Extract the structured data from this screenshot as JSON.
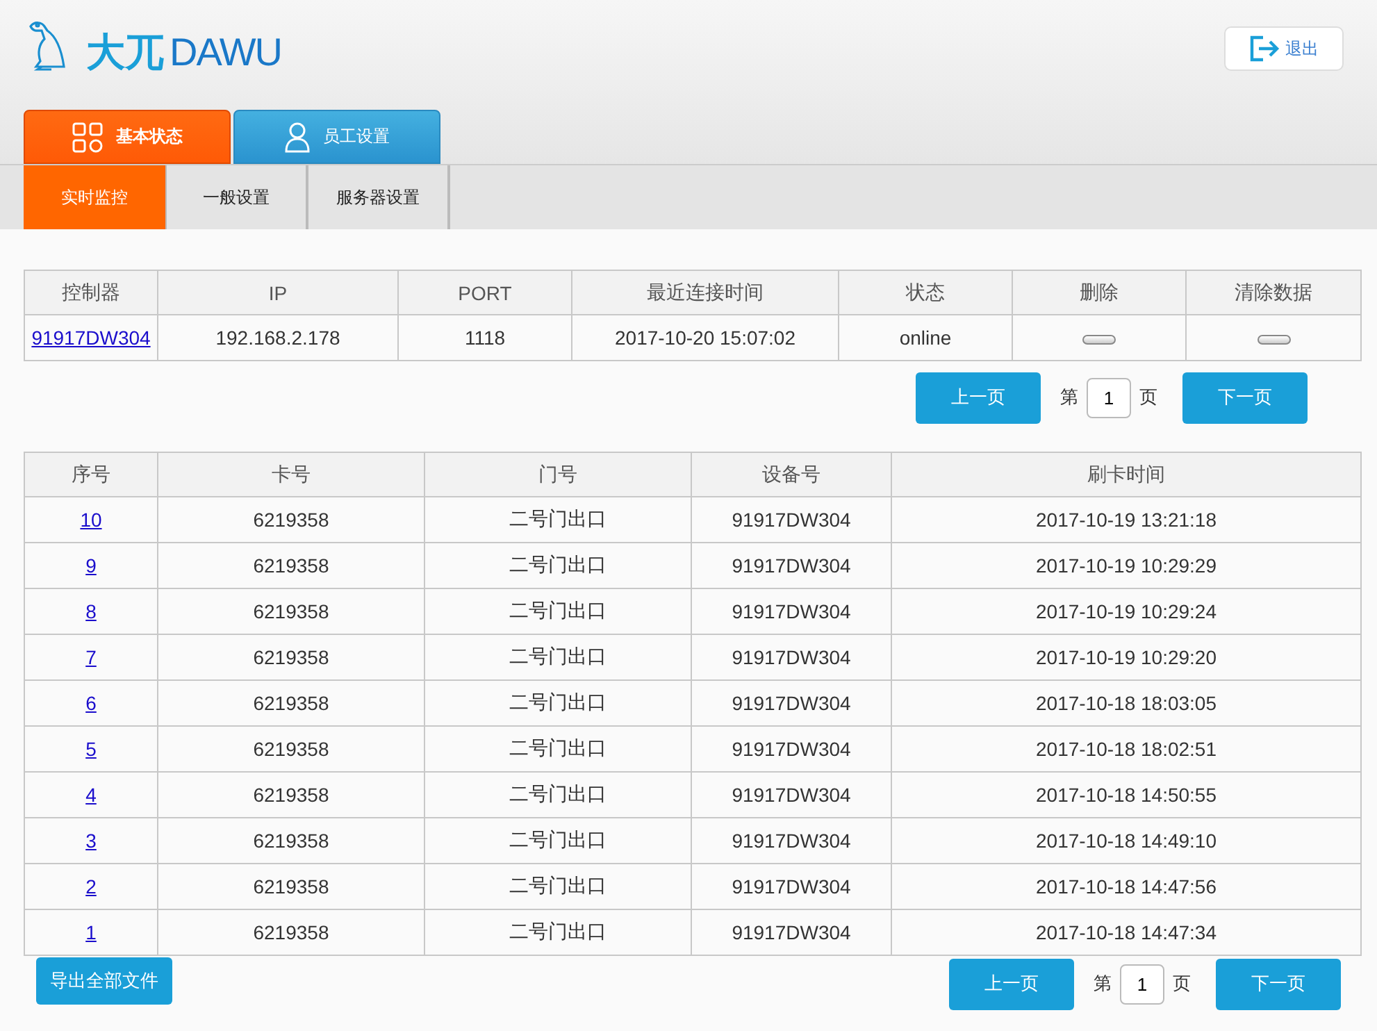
{
  "logo": {
    "mark": "大兀",
    "word": "DAWU"
  },
  "logout": {
    "label": "退出"
  },
  "tabs": [
    {
      "label": "基本状态",
      "kind": "grid",
      "selected": true
    },
    {
      "label": "员工设置",
      "kind": "user",
      "selected": false
    }
  ],
  "subtabs": [
    {
      "label": "实时监控",
      "selected": true
    },
    {
      "label": "一般设置",
      "selected": false
    },
    {
      "label": "服务器设置",
      "selected": false
    }
  ],
  "controllers": {
    "columns": [
      "控制器",
      "IP",
      "PORT",
      "最近连接时间",
      "状态",
      "删除",
      "清除数据"
    ],
    "rows": [
      {
        "controller": "91917DW304",
        "ip": "192.168.2.178",
        "port": "1118",
        "last_connected": "2017-10-20 15:07:02",
        "status": "online"
      }
    ]
  },
  "pager_top": {
    "prev": "上一页",
    "before": "第",
    "page": "1",
    "after": "页",
    "next": "下一页"
  },
  "records": {
    "columns": [
      "序号",
      "卡号",
      "门号",
      "设备号",
      "刷卡时间"
    ],
    "rows": [
      {
        "no": "10",
        "card": "6219358",
        "door": "二号门出口",
        "device": "91917DW304",
        "time": "2017-10-19 13:21:18"
      },
      {
        "no": "9",
        "card": "6219358",
        "door": "二号门出口",
        "device": "91917DW304",
        "time": "2017-10-19 10:29:29"
      },
      {
        "no": "8",
        "card": "6219358",
        "door": "二号门出口",
        "device": "91917DW304",
        "time": "2017-10-19 10:29:24"
      },
      {
        "no": "7",
        "card": "6219358",
        "door": "二号门出口",
        "device": "91917DW304",
        "time": "2017-10-19 10:29:20"
      },
      {
        "no": "6",
        "card": "6219358",
        "door": "二号门出口",
        "device": "91917DW304",
        "time": "2017-10-18 18:03:05"
      },
      {
        "no": "5",
        "card": "6219358",
        "door": "二号门出口",
        "device": "91917DW304",
        "time": "2017-10-18 18:02:51"
      },
      {
        "no": "4",
        "card": "6219358",
        "door": "二号门出口",
        "device": "91917DW304",
        "time": "2017-10-18 14:50:55"
      },
      {
        "no": "3",
        "card": "6219358",
        "door": "二号门出口",
        "device": "91917DW304",
        "time": "2017-10-18 14:49:10"
      },
      {
        "no": "2",
        "card": "6219358",
        "door": "二号门出口",
        "device": "91917DW304",
        "time": "2017-10-18 14:47:56"
      },
      {
        "no": "1",
        "card": "6219358",
        "door": "二号门出口",
        "device": "91917DW304",
        "time": "2017-10-18 14:47:34"
      }
    ]
  },
  "export": {
    "label": "导出全部文件"
  },
  "pager_bottom": {
    "prev": "上一页",
    "before": "第",
    "page": "1",
    "after": "页",
    "next": "下一页"
  }
}
